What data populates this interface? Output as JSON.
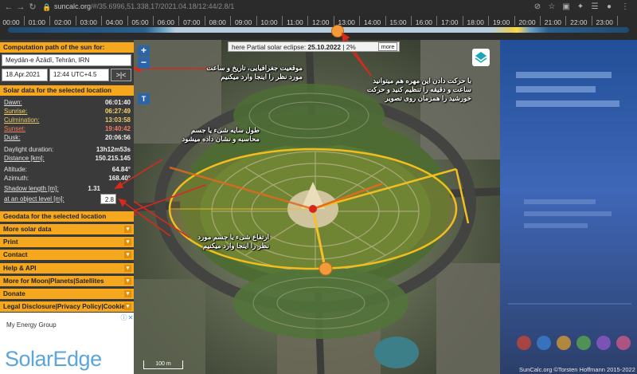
{
  "browser": {
    "url_host": "suncalc.org",
    "url_path": "/#/35.6996,51.338,17/2021.04.18/12:44/2.8/1"
  },
  "timeline": {
    "hours": [
      "00:00",
      "01:00",
      "02:00",
      "03:00",
      "04:00",
      "05:00",
      "06:00",
      "07:00",
      "08:00",
      "09:00",
      "10:00",
      "11:00",
      "12:00",
      "13:00",
      "14:00",
      "15:00",
      "16:00",
      "17:00",
      "18:00",
      "19:00",
      "20:00",
      "21:00",
      "22:00",
      "23:00"
    ],
    "current_time_fraction": 0.53
  },
  "sidebar": {
    "computation_header": "Computation path of the sun for:",
    "location_value": "Meydān-e Āzādī, Tehrān, IRN",
    "date_value": "18.Apr.2021",
    "time_value": "12:44 UTC+4.5",
    "now_button": ">|<",
    "solar_header": "Solar data for the selected location",
    "rows": [
      {
        "label": "Dawn:",
        "value": "06:01:40"
      },
      {
        "label": "Sunrise:",
        "value": "06:27:49"
      },
      {
        "label": "Culmination:",
        "value": "13:03:58"
      },
      {
        "label": "Sunset:",
        "value": "19:40:42"
      },
      {
        "label": "Dusk:",
        "value": "20:06:56"
      },
      {
        "label": "Daylight duration:",
        "value": "13h12m53s"
      },
      {
        "label": "Distance [km]:",
        "value": "150.215.145"
      },
      {
        "label": "Altitude:",
        "value": "64.84°"
      },
      {
        "label": "Azimuth:",
        "value": "168.40°"
      },
      {
        "label": "Shadow length [m]:",
        "value": "1.31"
      }
    ],
    "object_level_label": "at an object level [m]:",
    "object_level_value": "2.8",
    "geodata_header": "Geodata for the selected location",
    "menu": [
      "More solar data",
      "Print",
      "Contact",
      "Help & API",
      "More for Moon|Planets|Satellites",
      "Donate",
      "Legal Disclosure|Privacy Policy|Cookies"
    ]
  },
  "ad": {
    "label": "My Energy Group",
    "logo_text": "SolarEdge"
  },
  "map": {
    "eclipse_prefix": "here Partial solar eclipse:",
    "eclipse_date": "25.10.2022",
    "eclipse_percent": "2%",
    "more_label": "more",
    "zoom_in": "+",
    "zoom_out": "−",
    "t_label": "T",
    "scale_label": "100 m",
    "copyright": "SunCalc.org ©Torsten Hoffmann 2015-2022"
  },
  "annotations": {
    "location": [
      "موقعیت جغرافیایی، تاریخ و ساعت",
      "مورد نظر را اینجا وارد میکنیم"
    ],
    "slider": [
      "با حرکت دادن این مهره هم میتوانید",
      "ساعت و دقیقه را تنظیم کنید و حرکت",
      "خورشید را همزمان روی تصویر"
    ],
    "shadow": [
      "طول سایه شیء یا جسم",
      "محاسبه و نشان داده میشود"
    ],
    "height": [
      "ارتفاع شیء یا جسم مورد",
      "نظر را اینجا وارد میکنیم"
    ]
  }
}
